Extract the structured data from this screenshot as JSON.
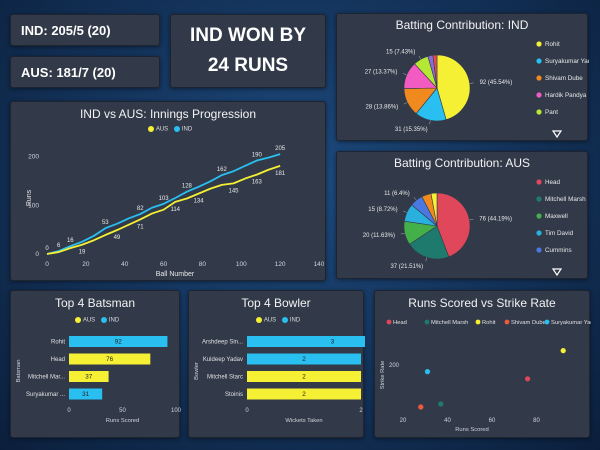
{
  "scores": {
    "ind": "IND: 205/5 (20)",
    "aus": "AUS: 181/7 (20)",
    "result_line1": "IND WON BY",
    "result_line2": "24 RUNS"
  },
  "colors": {
    "aus": "#f5f033",
    "ind": "#29bff0",
    "bg_card": "#323a49"
  },
  "charts": {
    "innings": {
      "title": "IND vs AUS: Innings Progression",
      "legend": [
        "AUS",
        "IND"
      ],
      "xlabel": "Ball Number",
      "ylabel": "Runs"
    },
    "bat_ind": {
      "title": "Batting Contribution: IND",
      "legend": [
        "Rohit",
        "Suryakumar Yadav",
        "Shivam Dube",
        "Hardik Pandya",
        "Pant"
      ]
    },
    "bat_aus": {
      "title": "Batting Contribution: AUS",
      "legend": [
        "Head",
        "Mitchell Marsh",
        "Maxwell",
        "Tim David",
        "Cummins"
      ]
    },
    "top_bat": {
      "title": "Top 4 Batsman",
      "legend": [
        "AUS",
        "IND"
      ],
      "xlabel": "Runs Scored",
      "ylabel": "Batsman"
    },
    "top_bowl": {
      "title": "Top 4 Bowler",
      "legend": [
        "AUS",
        "IND"
      ],
      "xlabel": "Wickets Taken",
      "ylabel": "Bowler"
    },
    "scatter": {
      "title": "Runs Scored vs Strike Rate",
      "legend": [
        "Head",
        "Mitchell Marsh",
        "Rohit",
        "Shivam Dube",
        "Suryakumar Yadav"
      ],
      "xlabel": "Runs Scored",
      "ylabel": "Strike Rate"
    }
  },
  "chart_data": [
    {
      "type": "line",
      "title": "IND vs AUS: Innings Progression",
      "xlabel": "Ball Number",
      "ylabel": "Runs",
      "xlim": [
        0,
        140
      ],
      "ylim": [
        0,
        230
      ],
      "xticks": [
        0,
        20,
        40,
        60,
        80,
        100,
        120,
        140
      ],
      "yticks": [
        0,
        100,
        200
      ],
      "series": [
        {
          "name": "IND",
          "color": "#29bff0",
          "x": [
            0,
            6,
            12,
            18,
            24,
            30,
            36,
            42,
            48,
            54,
            60,
            66,
            72,
            78,
            84,
            90,
            96,
            102,
            108,
            114,
            120
          ],
          "y": [
            0,
            6,
            16,
            25,
            37,
            53,
            62,
            73,
            82,
            95,
            103,
            115,
            128,
            138,
            149,
            162,
            170,
            181,
            192,
            198,
            205
          ],
          "labels": [
            0,
            6,
            16,
            null,
            null,
            53,
            null,
            null,
            82,
            null,
            103,
            null,
            128,
            null,
            null,
            162,
            null,
            null,
            190,
            null,
            205
          ]
        },
        {
          "name": "AUS",
          "color": "#f5f033",
          "x": [
            0,
            6,
            12,
            18,
            24,
            30,
            36,
            42,
            48,
            54,
            60,
            66,
            72,
            78,
            84,
            90,
            96,
            102,
            108,
            114,
            120
          ],
          "y": [
            0,
            4,
            12,
            19,
            28,
            39,
            49,
            60,
            71,
            83,
            91,
            107,
            114,
            124,
            134,
            142,
            145,
            155,
            163,
            173,
            181
          ],
          "labels": [
            null,
            null,
            null,
            19,
            null,
            null,
            49,
            null,
            71,
            null,
            null,
            114,
            null,
            134,
            null,
            null,
            145,
            null,
            163,
            null,
            181
          ]
        }
      ]
    },
    {
      "type": "pie",
      "title": "Batting Contribution: IND",
      "categories": [
        "Rohit",
        "Suryakumar Yadav",
        "Shivam Dube",
        "Hardik Pandya",
        "Pant"
      ],
      "values": [
        92,
        31,
        28,
        27,
        15
      ],
      "labels": [
        "92 (45.54%)",
        "31 (15.35%)",
        "28 (13.86%)",
        "27 (13.37%)",
        "15 (7.43%)"
      ],
      "colors": [
        "#f5f033",
        "#29bff0",
        "#f08a1e",
        "#f25cc2",
        "#b5e835",
        "#8a6cd8",
        "#e64a4a"
      ],
      "others": [
        5,
        4
      ]
    },
    {
      "type": "pie",
      "title": "Batting Contribution: AUS",
      "categories": [
        "Head",
        "Mitchell Marsh",
        "Maxwell",
        "Tim David",
        "Cummins"
      ],
      "values": [
        76,
        37,
        20,
        15,
        11
      ],
      "labels": [
        "76 (44.19%)",
        "37 (21.51%)",
        "20 (11.63%)",
        "15 (8.72%)",
        "11 (6.4%)"
      ],
      "colors": [
        "#e0475a",
        "#1f7a6e",
        "#44b04a",
        "#2ab0df",
        "#4a78e0",
        "#f08a1e",
        "#f5f033"
      ],
      "others": [
        8,
        5
      ]
    },
    {
      "type": "bar",
      "orientation": "horizontal",
      "title": "Top 4 Batsman",
      "categories": [
        "Rohit",
        "Head",
        "Mitchell Mar...",
        "Suryakumar ..."
      ],
      "values": [
        92,
        76,
        37,
        31
      ],
      "teams": [
        "IND",
        "AUS",
        "AUS",
        "IND"
      ],
      "xlabel": "Runs Scored",
      "ylabel": "Batsman",
      "xlim": [
        0,
        100
      ],
      "xticks": [
        0,
        50,
        100
      ]
    },
    {
      "type": "bar",
      "orientation": "horizontal",
      "title": "Top 4 Bowler",
      "categories": [
        "Arshdeep Sin...",
        "Kuldeep Yadav",
        "Mitchell Starc",
        "Stoinis"
      ],
      "values": [
        3,
        2,
        2,
        2
      ],
      "teams": [
        "IND",
        "IND",
        "AUS",
        "AUS"
      ],
      "xlabel": "Wickets Taken",
      "ylabel": "Bowler",
      "xlim": [
        0,
        2
      ],
      "xticks": [
        0,
        2
      ]
    },
    {
      "type": "scatter",
      "title": "Runs Scored vs Strike Rate",
      "xlabel": "Runs Scored",
      "ylabel": "Strike Rate",
      "xlim": [
        20,
        100
      ],
      "ylim": [
        120,
        250
      ],
      "xticks": [
        20,
        40,
        60,
        80
      ],
      "yticks": [
        200
      ],
      "series": [
        {
          "name": "Head",
          "color": "#e0475a",
          "x": [
            76
          ],
          "y": [
            177
          ]
        },
        {
          "name": "Mitchell Marsh",
          "color": "#1f7a6e",
          "x": [
            37
          ],
          "y": [
            135
          ]
        },
        {
          "name": "Rohit",
          "color": "#f5f033",
          "x": [
            92
          ],
          "y": [
            224
          ]
        },
        {
          "name": "Shivam Dube",
          "color": "#f05a3c",
          "x": [
            28
          ],
          "y": [
            130
          ]
        },
        {
          "name": "Suryakumar Yadav",
          "color": "#29bff0",
          "x": [
            31
          ],
          "y": [
            189
          ]
        }
      ]
    }
  ]
}
